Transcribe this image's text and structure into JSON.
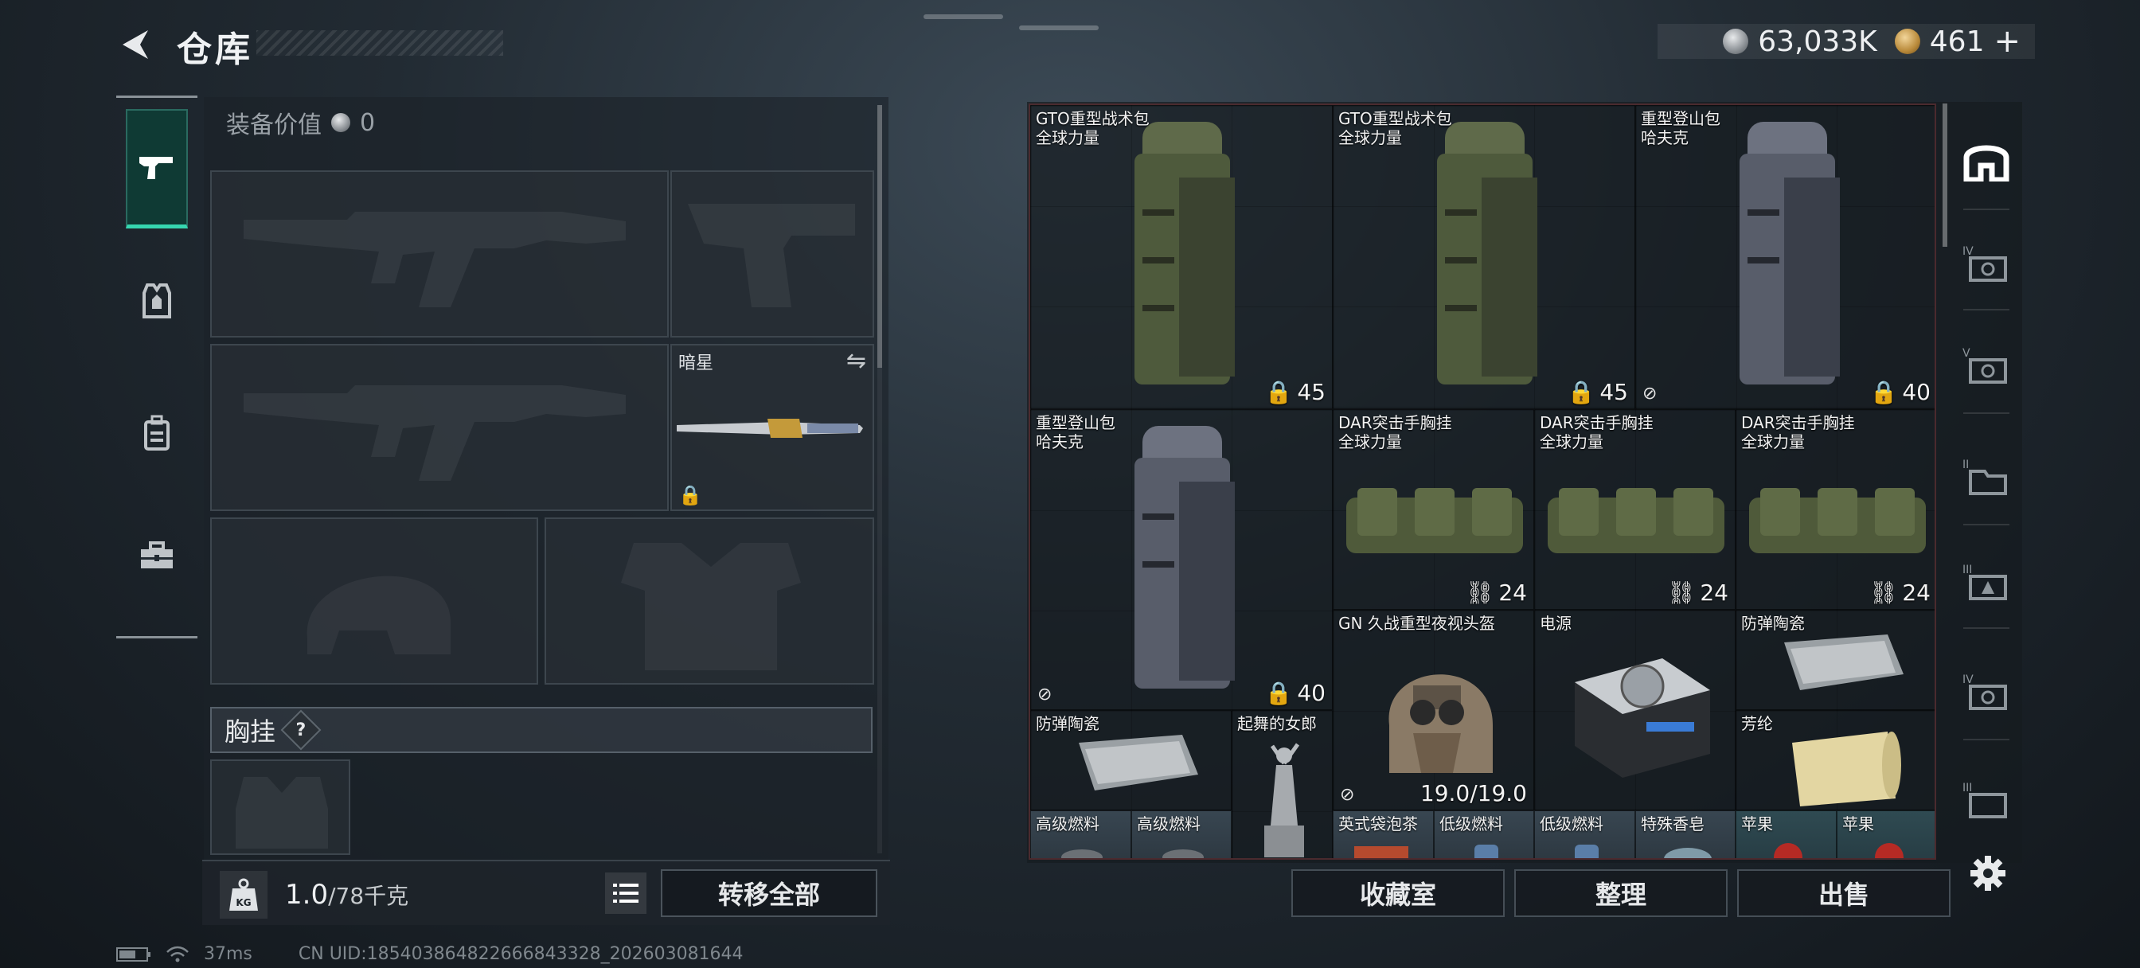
{
  "header": {
    "title": "仓库",
    "silver_amount": "63,033K",
    "gold_amount": "461",
    "gold_add": "+"
  },
  "left_tabs": [
    {
      "icon": "pistol-icon",
      "active": true
    },
    {
      "icon": "armor-icon",
      "active": false
    },
    {
      "icon": "backpack-icon",
      "active": false
    },
    {
      "icon": "toolbox-icon",
      "active": false
    }
  ],
  "equipment": {
    "value_label": "装备价值",
    "value_amount": "0",
    "melee_name": "暗星",
    "chest_section_label": "胸挂",
    "help_symbol": "?"
  },
  "weight": {
    "kg_icon": "KG",
    "current": "1.0",
    "total": "/78千克",
    "transfer_all_label": "转移全部"
  },
  "stash": {
    "items": [
      {
        "name1": "GTO重型战术包",
        "name2": "全球力量",
        "count": "45"
      },
      {
        "name1": "GTO重型战术包",
        "name2": "全球力量",
        "count": "45"
      },
      {
        "name1": "重型登山包",
        "name2": "哈夫克",
        "count": "40"
      },
      {
        "name1": "重型登山包",
        "name2": "哈夫克",
        "count": "40"
      },
      {
        "name1": "DAR突击手胸挂",
        "name2": "全球力量",
        "count": "24"
      },
      {
        "name1": "DAR突击手胸挂",
        "name2": "全球力量",
        "count": "24"
      },
      {
        "name1": "DAR突击手胸挂",
        "name2": "全球力量",
        "count": "24"
      },
      {
        "name1": "GN 久战重型夜视头盔",
        "count": "19.0/19.0"
      },
      {
        "name1": "电源"
      },
      {
        "name1": "防弹陶瓷"
      },
      {
        "name1": "防弹陶瓷"
      },
      {
        "name1": "起舞的女郎"
      },
      {
        "name1": "芳纶"
      },
      {
        "name1": "高级燃料"
      },
      {
        "name1": "高级燃料"
      },
      {
        "name1": "英式袋泡茶"
      },
      {
        "name1": "低级燃料"
      },
      {
        "name1": "低级燃料"
      },
      {
        "name1": "特殊香皂"
      },
      {
        "name1": "苹果"
      },
      {
        "name1": "苹果"
      }
    ]
  },
  "actions": {
    "collection": "收藏室",
    "organize": "整理",
    "sell": "出售"
  },
  "side_rail": [
    "home-icon",
    "tier-iv-icon",
    "tier-v-icon",
    "tier-ii-icon",
    "tier-iii-icon",
    "tier-iv-icon",
    "tier-iii-icon"
  ],
  "status": {
    "ping": "37ms",
    "uid": "CN UID:1854038648226668433​28_202603081644"
  },
  "colors": {
    "accent_teal": "#36d6b0",
    "rarity_red": "#6d2a32",
    "rarity_tan": "#4d3d33",
    "rarity_slate": "#384651"
  }
}
